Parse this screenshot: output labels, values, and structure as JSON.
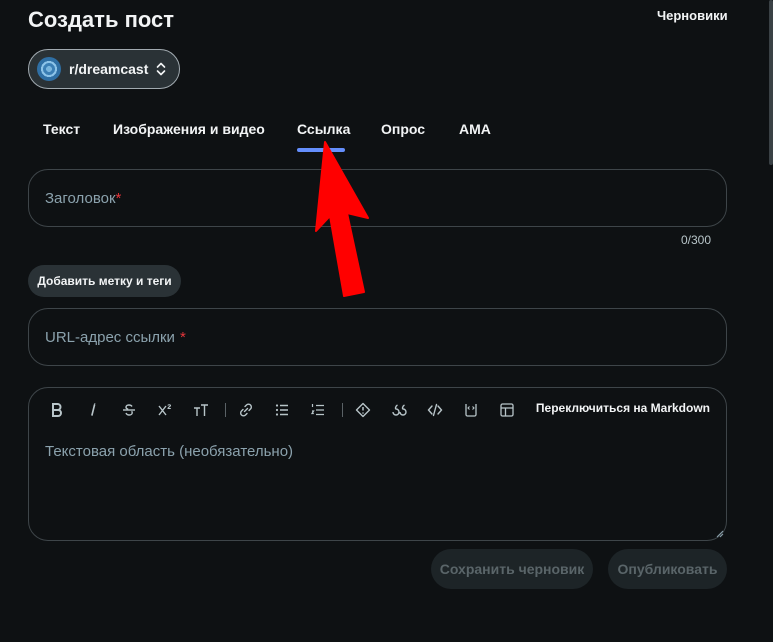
{
  "header": {
    "title": "Создать пост",
    "drafts_label": "Черновики"
  },
  "community": {
    "name": "r/dreamcast"
  },
  "tabs": [
    {
      "label": "Текст",
      "active": false
    },
    {
      "label": "Изображения и видео",
      "active": false
    },
    {
      "label": "Ссылка",
      "active": true
    },
    {
      "label": "Опрос",
      "active": false
    },
    {
      "label": "AMA",
      "active": false
    }
  ],
  "title_field": {
    "placeholder": "Заголовок",
    "required_mark": "*",
    "counter": "0/300"
  },
  "tags_button_label": "Добавить метку и теги",
  "url_field": {
    "placeholder": "URL-адрес ссылки",
    "required_mark": "*"
  },
  "editor": {
    "toolbar": [
      "bold-icon",
      "italic-icon",
      "strikethrough-icon",
      "superscript-icon",
      "heading-icon",
      "link-icon",
      "bullet-list-icon",
      "numbered-list-icon",
      "spoiler-icon",
      "quote-icon",
      "code-icon",
      "code-block-icon",
      "table-icon"
    ],
    "markdown_switch": "Переключиться на Markdown",
    "placeholder": "Текстовая область (необязательно)"
  },
  "actions": {
    "save_draft": "Сохранить черновик",
    "publish": "Опубликовать"
  },
  "colors": {
    "background": "#0e1113",
    "accent_underline": "#648efc",
    "required": "#e5363b",
    "annotation_arrow": "#ff0000"
  }
}
